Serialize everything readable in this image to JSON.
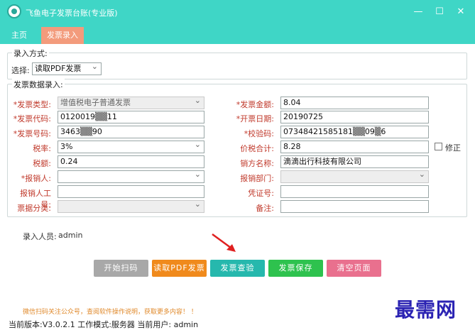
{
  "window": {
    "title": "飞鱼电子发票台账(专业版)",
    "controls": {
      "minimize": "—",
      "maximize": "☐",
      "close": "✕"
    }
  },
  "tabs": [
    {
      "label": "主页",
      "active": false
    },
    {
      "label": "发票录入",
      "active": true
    }
  ],
  "entry_mode": {
    "legend": "录入方式:",
    "select_label": "选择:",
    "select_value": "读取PDF发票"
  },
  "invoice": {
    "legend": "发票数据录入:",
    "left": [
      {
        "label": "*发票类型:",
        "value": "增值税电子普通发票",
        "required": true,
        "type": "select",
        "disabled": true
      },
      {
        "label": "*发票代码:",
        "value": "0120019▒▒11",
        "required": true,
        "type": "text"
      },
      {
        "label": "*发票号码:",
        "value": "3463▒▒90",
        "required": true,
        "type": "text"
      },
      {
        "label": "税率:",
        "value": "3%",
        "required": false,
        "type": "select"
      },
      {
        "label": "税额:",
        "value": "0.24",
        "required": false,
        "type": "text"
      },
      {
        "label": "*报销人:",
        "value": "",
        "required": true,
        "type": "select"
      },
      {
        "label": "报销人工号:",
        "value": "",
        "required": false,
        "type": "text"
      },
      {
        "label": "票据分类:",
        "value": "",
        "required": false,
        "type": "select",
        "disabled": true
      }
    ],
    "right": [
      {
        "label": "*发票金额:",
        "value": "8.04",
        "required": true,
        "type": "text"
      },
      {
        "label": "*开票日期:",
        "value": "20190725",
        "required": true,
        "type": "text"
      },
      {
        "label": "*校验码:",
        "value": "07348421585181▒▒09▒6",
        "required": true,
        "type": "text"
      },
      {
        "label": "价税合计:",
        "value": "8.28",
        "required": false,
        "type": "text"
      },
      {
        "label": "销方名称:",
        "value": "滴滴出行科技有限公司",
        "required": false,
        "type": "text"
      },
      {
        "label": "报销部门:",
        "value": "",
        "required": false,
        "type": "select",
        "disabled": true
      },
      {
        "label": "凭证号:",
        "value": "",
        "required": false,
        "type": "text"
      },
      {
        "label": "备注:",
        "value": "",
        "required": false,
        "type": "text"
      }
    ],
    "modify_label": "修正"
  },
  "operator": {
    "label": "录入人员:",
    "value": "admin"
  },
  "buttons": {
    "start_scan": "开始扫码",
    "read_pdf": "读取PDF发票",
    "verify": "发票查验",
    "save": "发票保存",
    "clear": "清空页面"
  },
  "colors": {
    "titlebar": "#3fd6c6",
    "active_tab": "#f39b7c",
    "start_scan": "#a8a8a8",
    "read_pdf": "#f08a1c",
    "verify": "#26b8ad",
    "save": "#2ec24e",
    "clear": "#e9708e"
  },
  "notice": "微信扫码关注公众号，查阅软件操作说明，获取更多内容！    ！",
  "statusbar": "当前版本:V3.0.2.1  工作模式:服务器  当前用户: admin",
  "watermark": "最需网"
}
